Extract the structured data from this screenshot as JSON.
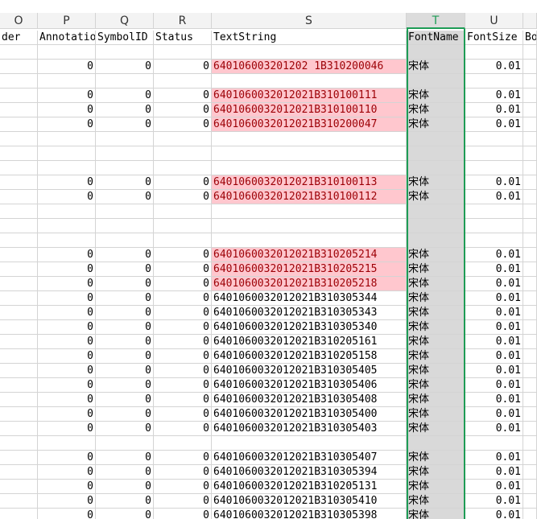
{
  "columns": [
    {
      "letter": "O",
      "header": "der"
    },
    {
      "letter": "P",
      "header": "Annotatio"
    },
    {
      "letter": "Q",
      "header": "SymbolID"
    },
    {
      "letter": "R",
      "header": "Status"
    },
    {
      "letter": "S",
      "header": "TextString"
    },
    {
      "letter": "T",
      "header": "FontName"
    },
    {
      "letter": "U",
      "header": "FontSize"
    },
    {
      "letter": "",
      "header": "Bo"
    }
  ],
  "selected_column": "T",
  "highlight_color": "#ffc7ce",
  "selection_color": "#1e9c56",
  "rows": [
    {
      "empty": true
    },
    {
      "p": "0",
      "q": "0",
      "r": "0",
      "s": "640106003201202 1B310200046",
      "font": "宋体",
      "size": "0.01",
      "pink": true
    },
    {
      "empty": true
    },
    {
      "p": "0",
      "q": "0",
      "r": "0",
      "s": "6401060032012021B310100111",
      "font": "宋体",
      "size": "0.01",
      "pink": true
    },
    {
      "p": "0",
      "q": "0",
      "r": "0",
      "s": "6401060032012021B310100110",
      "font": "宋体",
      "size": "0.01",
      "pink": true
    },
    {
      "p": "0",
      "q": "0",
      "r": "0",
      "s": "6401060032012021B310200047",
      "font": "宋体",
      "size": "0.01",
      "pink": true
    },
    {
      "empty": true
    },
    {
      "empty": true
    },
    {
      "empty": true
    },
    {
      "p": "0",
      "q": "0",
      "r": "0",
      "s": "6401060032012021B310100113",
      "font": "宋体",
      "size": "0.01",
      "pink": true
    },
    {
      "p": "0",
      "q": "0",
      "r": "0",
      "s": "6401060032012021B310100112",
      "font": "宋体",
      "size": "0.01",
      "pink": true
    },
    {
      "empty": true
    },
    {
      "empty": true
    },
    {
      "empty": true
    },
    {
      "p": "0",
      "q": "0",
      "r": "0",
      "s": "6401060032012021B310205214",
      "font": "宋体",
      "size": "0.01",
      "pink": true
    },
    {
      "p": "0",
      "q": "0",
      "r": "0",
      "s": "6401060032012021B310205215",
      "font": "宋体",
      "size": "0.01",
      "pink": true
    },
    {
      "p": "0",
      "q": "0",
      "r": "0",
      "s": "6401060032012021B310205218",
      "font": "宋体",
      "size": "0.01",
      "pink": true
    },
    {
      "p": "0",
      "q": "0",
      "r": "0",
      "s": "6401060032012021B310305344",
      "font": "宋体",
      "size": "0.01",
      "pink": false
    },
    {
      "p": "0",
      "q": "0",
      "r": "0",
      "s": "6401060032012021B310305343",
      "font": "宋体",
      "size": "0.01",
      "pink": false
    },
    {
      "p": "0",
      "q": "0",
      "r": "0",
      "s": "6401060032012021B310305340",
      "font": "宋体",
      "size": "0.01",
      "pink": false
    },
    {
      "p": "0",
      "q": "0",
      "r": "0",
      "s": "6401060032012021B310205161",
      "font": "宋体",
      "size": "0.01",
      "pink": false
    },
    {
      "p": "0",
      "q": "0",
      "r": "0",
      "s": "6401060032012021B310205158",
      "font": "宋体",
      "size": "0.01",
      "pink": false
    },
    {
      "p": "0",
      "q": "0",
      "r": "0",
      "s": "6401060032012021B310305405",
      "font": "宋体",
      "size": "0.01",
      "pink": false
    },
    {
      "p": "0",
      "q": "0",
      "r": "0",
      "s": "6401060032012021B310305406",
      "font": "宋体",
      "size": "0.01",
      "pink": false
    },
    {
      "p": "0",
      "q": "0",
      "r": "0",
      "s": "6401060032012021B310305408",
      "font": "宋体",
      "size": "0.01",
      "pink": false
    },
    {
      "p": "0",
      "q": "0",
      "r": "0",
      "s": "6401060032012021B310305400",
      "font": "宋体",
      "size": "0.01",
      "pink": false
    },
    {
      "p": "0",
      "q": "0",
      "r": "0",
      "s": "6401060032012021B310305403",
      "font": "宋体",
      "size": "0.01",
      "pink": false
    },
    {
      "empty": true
    },
    {
      "p": "0",
      "q": "0",
      "r": "0",
      "s": "6401060032012021B310305407",
      "font": "宋体",
      "size": "0.01",
      "pink": false
    },
    {
      "p": "0",
      "q": "0",
      "r": "0",
      "s": "6401060032012021B310305394",
      "font": "宋体",
      "size": "0.01",
      "pink": false
    },
    {
      "p": "0",
      "q": "0",
      "r": "0",
      "s": "6401060032012021B310205131",
      "font": "宋体",
      "size": "0.01",
      "pink": false
    },
    {
      "p": "0",
      "q": "0",
      "r": "0",
      "s": "6401060032012021B310305410",
      "font": "宋体",
      "size": "0.01",
      "pink": false
    },
    {
      "p": "0",
      "q": "0",
      "r": "0",
      "s": "6401060032012021B310305398",
      "font": "宋体",
      "size": "0.01",
      "pink": false
    }
  ]
}
